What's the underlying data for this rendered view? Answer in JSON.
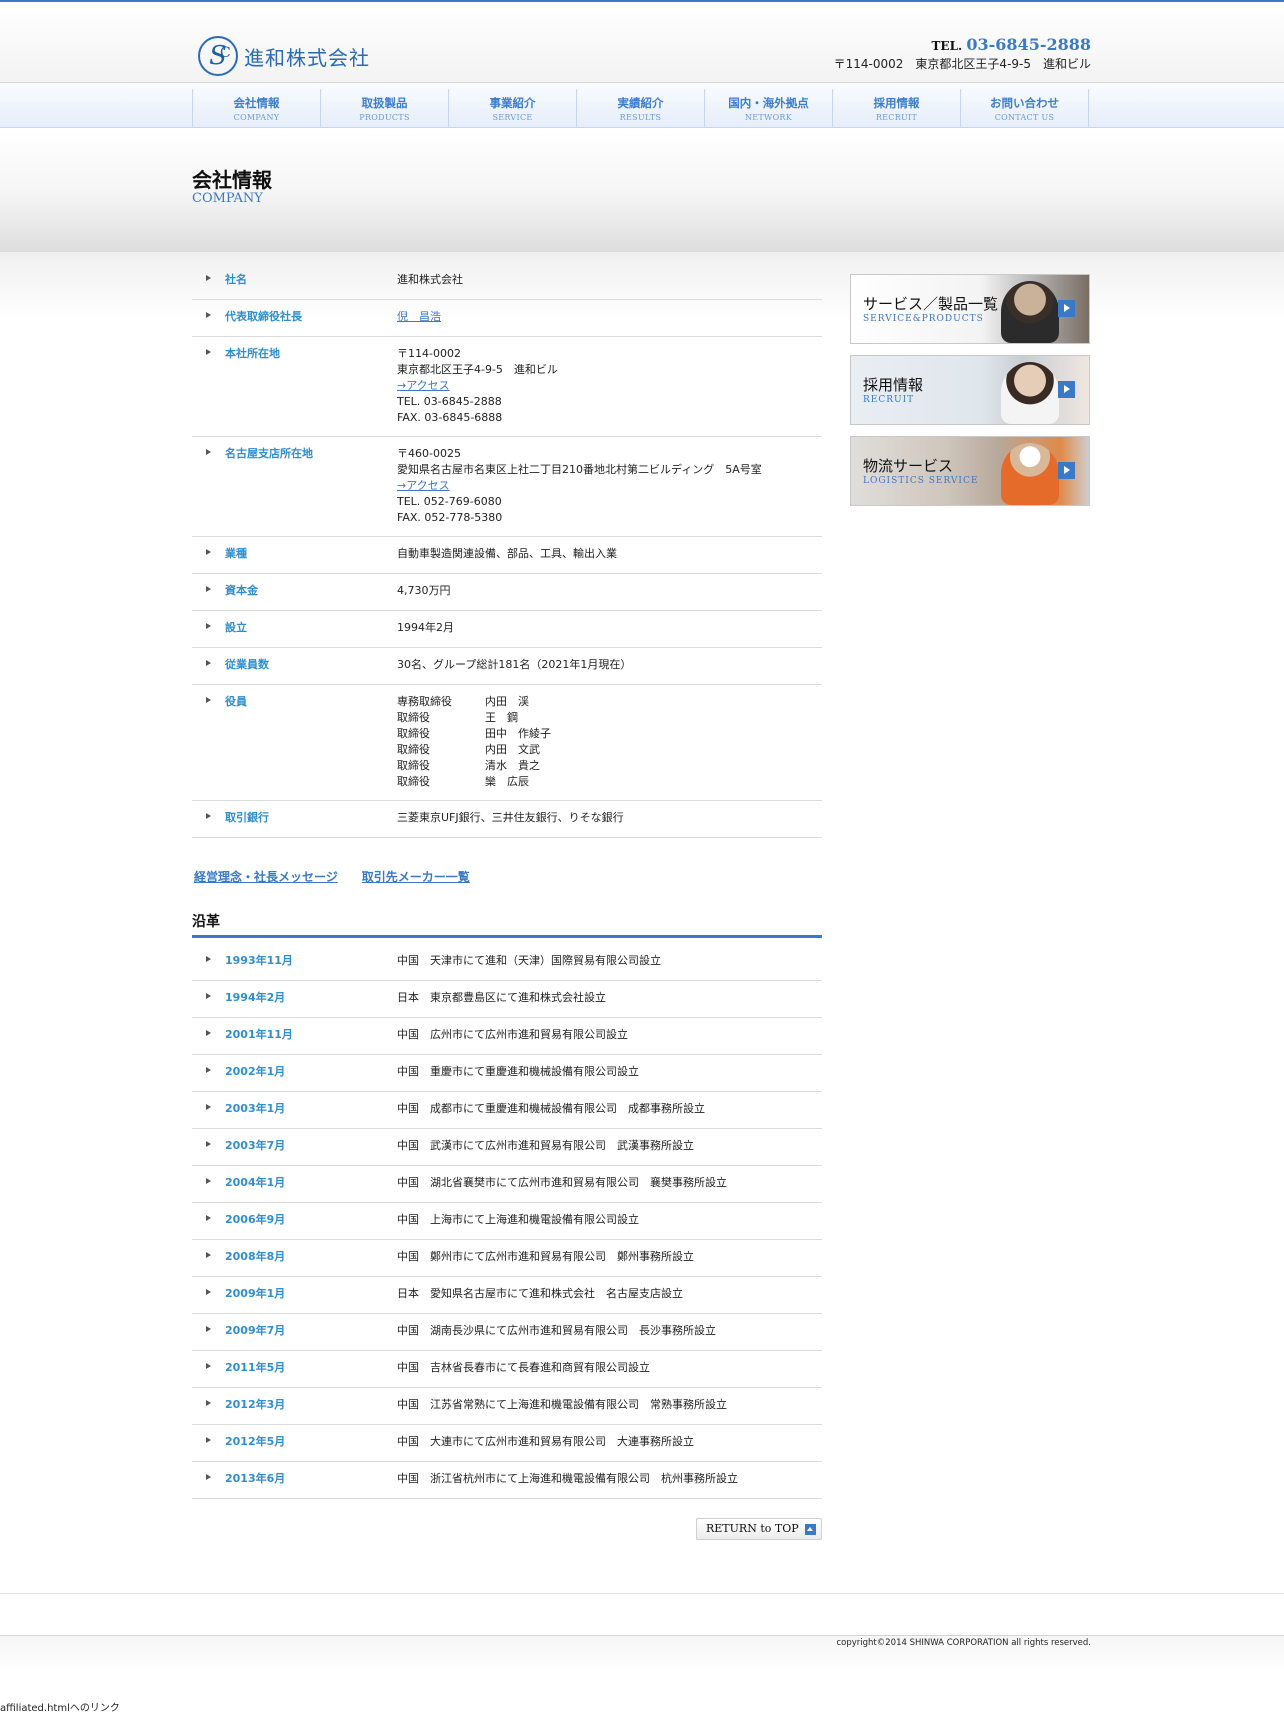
{
  "header": {
    "logo_mark": "S",
    "logo_mark_small": "C",
    "logo_text": "進和株式会社",
    "tel_label": "TEL.",
    "tel_number": "03-6845-2888",
    "address": "〒114-0002　東京都北区王子4-9-5　進和ビル"
  },
  "nav": [
    {
      "jp": "会社情報",
      "en": "COMPANY"
    },
    {
      "jp": "取扱製品",
      "en": "PRODUCTS"
    },
    {
      "jp": "事業紹介",
      "en": "SERVICE"
    },
    {
      "jp": "実績紹介",
      "en": "RESULTS"
    },
    {
      "jp": "国内・海外拠点",
      "en": "NETWORK"
    },
    {
      "jp": "採用情報",
      "en": "RECRUIT"
    },
    {
      "jp": "お問い合わせ",
      "en": "CONTACT US"
    }
  ],
  "page_title": {
    "jp": "会社情報",
    "en": "COMPANY"
  },
  "company": {
    "name": {
      "label": "社名",
      "value": "進和株式会社"
    },
    "ceo": {
      "label": "代表取締役社長",
      "value": "倪　昌浩"
    },
    "hq": {
      "label": "本社所在地",
      "postal": "〒114-0002",
      "address": "東京都北区王子4-9-5　進和ビル",
      "access": "→アクセス",
      "tel": "TEL. 03-6845-2888",
      "fax": "FAX. 03-6845-6888"
    },
    "nagoya": {
      "label": "名古屋支店所在地",
      "postal": "〒460-0025",
      "address": "愛知県名古屋市名東区上社二丁目210番地北村第二ビルディング　5A号室",
      "access": "→アクセス",
      "tel": "TEL. 052-769-6080",
      "fax": "FAX. 052-778-5380"
    },
    "industry": {
      "label": "業種",
      "value": "自動車製造関連設備、部品、工具、輸出入業"
    },
    "capital": {
      "label": "資本金",
      "value": "4,730万円"
    },
    "founded": {
      "label": "設立",
      "value": "1994年2月"
    },
    "employees": {
      "label": "従業員数",
      "value": "30名、グループ総計181名（2021年1月現在）"
    },
    "officers": {
      "label": "役員",
      "list": [
        {
          "role": "専務取締役",
          "name": "内田　渓"
        },
        {
          "role": "取締役",
          "name": "王　鋼"
        },
        {
          "role": "取締役",
          "name": "田中　作綾子"
        },
        {
          "role": "取締役",
          "name": "内田　文武"
        },
        {
          "role": "取締役",
          "name": "清水　貴之"
        },
        {
          "role": "取締役",
          "name": "欒　広辰"
        }
      ]
    },
    "banks": {
      "label": "取引銀行",
      "value": "三菱東京UFJ銀行、三井住友銀行、りそな銀行"
    }
  },
  "links": {
    "philosophy": "経営理念・社長メッセージ",
    "makers": "取引先メーカー一覧"
  },
  "history": {
    "title": "沿革",
    "items": [
      {
        "date": "1993年11月",
        "text": "中国　天津市にて進和（天津）国際貿易有限公司設立"
      },
      {
        "date": "1994年2月",
        "text": "日本　東京都豊島区にて進和株式会社設立"
      },
      {
        "date": "2001年11月",
        "text": "中国　広州市にて広州市進和貿易有限公司設立"
      },
      {
        "date": "2002年1月",
        "text": "中国　重慶市にて重慶進和機械設備有限公司設立"
      },
      {
        "date": "2003年1月",
        "text": "中国　成都市にて重慶進和機械設備有限公司　成都事務所設立"
      },
      {
        "date": "2003年7月",
        "text": "中国　武漢市にて広州市進和貿易有限公司　武漢事務所設立"
      },
      {
        "date": "2004年1月",
        "text": "中国　湖北省襄樊市にて広州市進和貿易有限公司　襄樊事務所設立"
      },
      {
        "date": "2006年9月",
        "text": "中国　上海市にて上海進和機電設備有限公司設立"
      },
      {
        "date": "2008年8月",
        "text": "中国　鄭州市にて広州市進和貿易有限公司　鄭州事務所設立"
      },
      {
        "date": "2009年1月",
        "text": "日本　愛知県名古屋市にて進和株式会社　名古屋支店設立"
      },
      {
        "date": "2009年7月",
        "text": "中国　湖南長沙県にて広州市進和貿易有限公司　長沙事務所設立"
      },
      {
        "date": "2011年5月",
        "text": "中国　吉林省長春市にて長春進和商貿有限公司設立"
      },
      {
        "date": "2012年3月",
        "text": "中国　江苏省常熟にて上海進和機電設備有限公司　常熟事務所設立"
      },
      {
        "date": "2012年5月",
        "text": "中国　大連市にて広州市進和貿易有限公司　大連事務所設立"
      },
      {
        "date": "2013年6月",
        "text": "中国　浙江省杭州市にて上海進和機電設備有限公司　杭州事務所設立"
      }
    ]
  },
  "return_top": "RETURN to TOP",
  "side": [
    {
      "jp": "サービス／製品一覧",
      "en": "SERVICE&PRODUCTS"
    },
    {
      "jp": "採用情報",
      "en": "RECRUIT"
    },
    {
      "jp": "物流サービス",
      "en": "LOGISTICS SERVICE"
    }
  ],
  "copyright": "copyright©2014 SHINWA CORPORATION all rights reserved.",
  "status_bar": "affiliated.htmlへのリンク",
  "colors": {
    "accent": "#3a78c8",
    "label_blue": "#2f8ed0"
  }
}
